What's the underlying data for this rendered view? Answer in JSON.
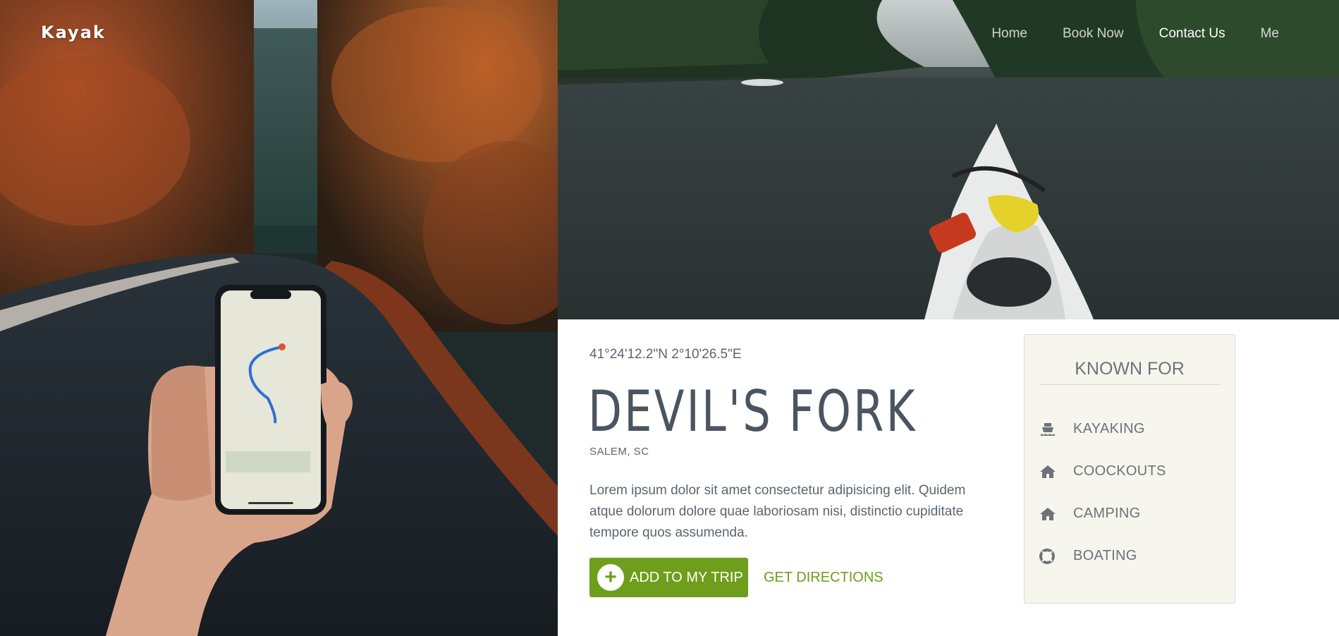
{
  "brand": {
    "name": "Kayak"
  },
  "nav": {
    "items": [
      {
        "label": "Home"
      },
      {
        "label": "Book Now"
      },
      {
        "label": "Contact Us"
      },
      {
        "label": "Me"
      }
    ],
    "active_index": 2
  },
  "destination": {
    "coordinates": "41°24'12.2\"N 2°10'26.5\"E",
    "title": "DEVIL'S FORK",
    "location": "SALEM, SC",
    "description": "Lorem ipsum dolor sit amet consectetur adipisicing elit. Quidem atque dolorum dolore quae laboriosam nisi, distinctio cupiditate tempore quos assumenda."
  },
  "actions": {
    "add_to_trip": "ADD TO MY TRIP",
    "add_icon_glyph": "+",
    "directions": "GET DIRECTIONS"
  },
  "known_for": {
    "title": "KNOWN FOR",
    "items": [
      {
        "label": "KAYAKING",
        "icon": "ship-icon"
      },
      {
        "label": "COOCKOUTS",
        "icon": "home-icon"
      },
      {
        "label": "CAMPING",
        "icon": "home-icon"
      },
      {
        "label": "BOATING",
        "icon": "life-ring-icon"
      }
    ]
  },
  "colors": {
    "accent": "#6e9e1c",
    "text": "#5b6670",
    "title": "#4a5561",
    "panel_bg": "#f6f5ee"
  }
}
